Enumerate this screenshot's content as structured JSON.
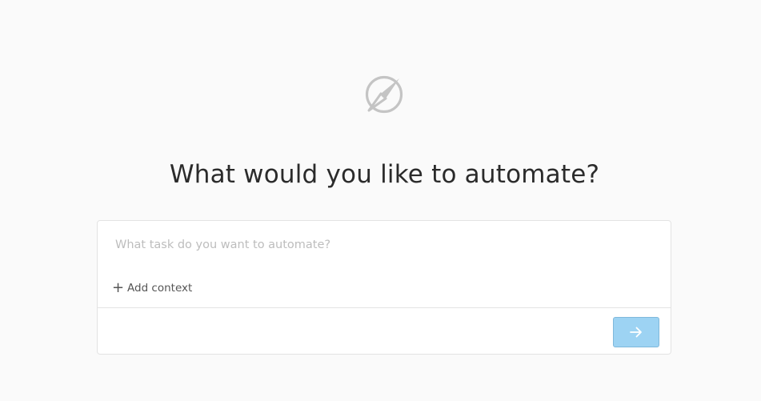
{
  "main": {
    "logo_icon": "compass-icon",
    "headline": "What would you like to automate?",
    "task_input": {
      "placeholder": "What task do you want to automate?",
      "value": ""
    },
    "add_context": {
      "icon": "plus-icon",
      "label": "Add context"
    },
    "submit": {
      "icon": "arrow-right-icon",
      "enabled": false
    }
  },
  "colors": {
    "background": "#fafafa",
    "submit_button": "#9dd3f3",
    "logo": "#c4c4c4",
    "headline": "#2b2b2b"
  }
}
